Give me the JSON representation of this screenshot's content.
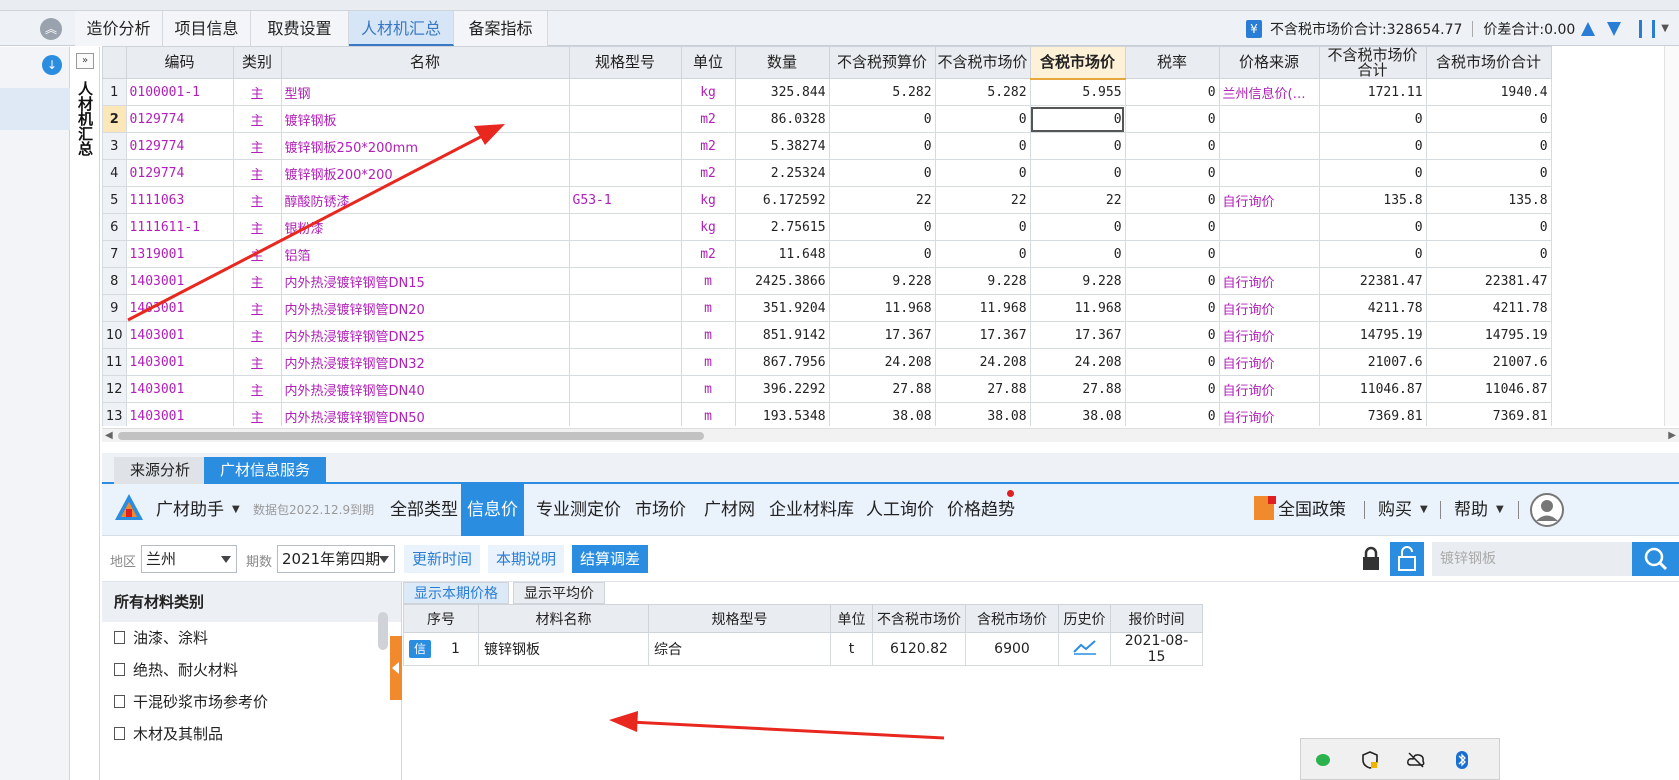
{
  "tabs": [
    "造价分析",
    "项目信息",
    "取费设置",
    "人材机汇总",
    "备案指标"
  ],
  "summary": {
    "tax_free_market_total": "不含税市场价合计:328654.77",
    "diff_total": "价差合计:0.00"
  },
  "side_label": "人材机汇总",
  "grid": {
    "columns": [
      "编码",
      "类别",
      "名称",
      "规格型号",
      "单位",
      "数量",
      "不含税预算价",
      "不含税市场价",
      "含税市场价",
      "税率",
      "价格来源",
      "不含税市场价合计",
      "含税市场价合计"
    ],
    "rows": [
      {
        "n": "1",
        "code": "0100001-1",
        "type": "主",
        "name": "型钢",
        "spec": "",
        "unit": "kg",
        "qty": "325.844",
        "budget": "5.282",
        "market": "5.282",
        "market_tax": "5.955",
        "rate": "0",
        "source": "兰州信息价(…",
        "total": "1721.11",
        "total_tax": "1940.4"
      },
      {
        "n": "2",
        "code": "0129774",
        "type": "主",
        "name": "镀锌钢板",
        "spec": "",
        "unit": "m2",
        "qty": "86.0328",
        "budget": "0",
        "market": "0",
        "market_tax": "0",
        "rate": "0",
        "source": "",
        "total": "0",
        "total_tax": "0"
      },
      {
        "n": "3",
        "code": "0129774",
        "type": "主",
        "name": "镀锌钢板250*200mm",
        "spec": "",
        "unit": "m2",
        "qty": "5.38274",
        "budget": "0",
        "market": "0",
        "market_tax": "0",
        "rate": "0",
        "source": "",
        "total": "0",
        "total_tax": "0"
      },
      {
        "n": "4",
        "code": "0129774",
        "type": "主",
        "name": "镀锌钢板200*200",
        "spec": "",
        "unit": "m2",
        "qty": "2.25324",
        "budget": "0",
        "market": "0",
        "market_tax": "0",
        "rate": "0",
        "source": "",
        "total": "0",
        "total_tax": "0"
      },
      {
        "n": "5",
        "code": "1111063",
        "type": "主",
        "name": "醇酸防锈漆",
        "spec": "G53-1",
        "unit": "kg",
        "qty": "6.172592",
        "budget": "22",
        "market": "22",
        "market_tax": "22",
        "rate": "0",
        "source": "自行询价",
        "total": "135.8",
        "total_tax": "135.8"
      },
      {
        "n": "6",
        "code": "1111611-1",
        "type": "主",
        "name": "银粉漆",
        "spec": "",
        "unit": "kg",
        "qty": "2.75615",
        "budget": "0",
        "market": "0",
        "market_tax": "0",
        "rate": "0",
        "source": "",
        "total": "0",
        "total_tax": "0"
      },
      {
        "n": "7",
        "code": "1319001",
        "type": "主",
        "name": "铝箔",
        "spec": "",
        "unit": "m2",
        "qty": "11.648",
        "budget": "0",
        "market": "0",
        "market_tax": "0",
        "rate": "0",
        "source": "",
        "total": "0",
        "total_tax": "0"
      },
      {
        "n": "8",
        "code": "1403001",
        "type": "主",
        "name": "内外热浸镀锌钢管DN15",
        "spec": "",
        "unit": "m",
        "qty": "2425.3866",
        "budget": "9.228",
        "market": "9.228",
        "market_tax": "9.228",
        "rate": "0",
        "source": "自行询价",
        "total": "22381.47",
        "total_tax": "22381.47"
      },
      {
        "n": "9",
        "code": "1403001",
        "type": "主",
        "name": "内外热浸镀锌钢管DN20",
        "spec": "",
        "unit": "m",
        "qty": "351.9204",
        "budget": "11.968",
        "market": "11.968",
        "market_tax": "11.968",
        "rate": "0",
        "source": "自行询价",
        "total": "4211.78",
        "total_tax": "4211.78"
      },
      {
        "n": "10",
        "code": "1403001",
        "type": "主",
        "name": "内外热浸镀锌钢管DN25",
        "spec": "",
        "unit": "m",
        "qty": "851.9142",
        "budget": "17.367",
        "market": "17.367",
        "market_tax": "17.367",
        "rate": "0",
        "source": "自行询价",
        "total": "14795.19",
        "total_tax": "14795.19"
      },
      {
        "n": "11",
        "code": "1403001",
        "type": "主",
        "name": "内外热浸镀锌钢管DN32",
        "spec": "",
        "unit": "m",
        "qty": "867.7956",
        "budget": "24.208",
        "market": "24.208",
        "market_tax": "24.208",
        "rate": "0",
        "source": "自行询价",
        "total": "21007.6",
        "total_tax": "21007.6"
      },
      {
        "n": "12",
        "code": "1403001",
        "type": "主",
        "name": "内外热浸镀锌钢管DN40",
        "spec": "",
        "unit": "m",
        "qty": "396.2292",
        "budget": "27.88",
        "market": "27.88",
        "market_tax": "27.88",
        "rate": "0",
        "source": "自行询价",
        "total": "11046.87",
        "total_tax": "11046.87"
      },
      {
        "n": "13",
        "code": "1403001",
        "type": "主",
        "name": "内外热浸镀锌钢管DN50",
        "spec": "",
        "unit": "m",
        "qty": "193.5348",
        "budget": "38.08",
        "market": "38.08",
        "market_tax": "38.08",
        "rate": "0",
        "source": "自行询价",
        "total": "7369.81",
        "total_tax": "7369.81"
      }
    ]
  },
  "bottom_tabs": [
    "来源分析",
    "广材信息服务"
  ],
  "assistant": {
    "name": "广材助手",
    "data_package": "数据包2022.12.9到期",
    "nav": [
      "全部类型",
      "信息价",
      "专业测定价",
      "市场价",
      "广材网",
      "企业材料库",
      "人工询价",
      "价格趋势"
    ],
    "right_links": [
      "全国政策",
      "购买",
      "帮助"
    ]
  },
  "filter": {
    "region_label": "地区",
    "region": "兰州",
    "period_label": "期数",
    "period": "2021年第四期",
    "btn_update": "更新时间",
    "btn_note": "本期说明",
    "btn_settle": "结算调差",
    "search_placeholder": "镀锌钢板"
  },
  "categories": {
    "header": "所有材料类别",
    "items": [
      "油漆、涂料",
      "绝热、耐火材料",
      "干混砂浆市场参考价",
      "木材及其制品"
    ]
  },
  "result": {
    "tabs": [
      "显示本期价格",
      "显示平均价"
    ],
    "columns": [
      "序号",
      "材料名称",
      "规格型号",
      "单位",
      "不含税市场价",
      "含税市场价",
      "历史价",
      "报价时间"
    ],
    "badge": "信",
    "row": {
      "n": "1",
      "name": "镀锌钢板",
      "spec": "综合",
      "unit": "t",
      "price": "6120.82",
      "price_tax": "6900",
      "date": "2021-08-15"
    }
  },
  "icons": [
    "collapse-icon",
    "yen-icon",
    "arrow-up-icon",
    "arrow-down-icon",
    "download-icon",
    "expand-icon",
    "logo-icon",
    "dropdown-icon",
    "lock-icon",
    "unlock-icon",
    "search-icon",
    "user-avatar-icon",
    "file-icon",
    "trend-icon",
    "wechat-icon",
    "shield-icon",
    "cloud-icon",
    "bluetooth-icon"
  ],
  "colors": {
    "accent": "#2a8de0",
    "material_text": "#b020b8",
    "annotation_arrow": "#e8281e",
    "handle": "#f08a2c"
  }
}
